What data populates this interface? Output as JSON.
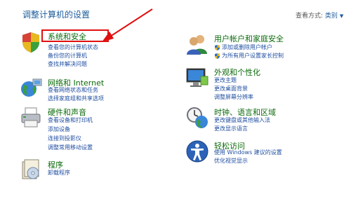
{
  "header": {
    "title": "调整计算机的设置",
    "view_by_label": "查看方式:",
    "view_by_value": "类别"
  },
  "categories_left": [
    {
      "title": "系统和安全",
      "links": [
        "查看您的计算机状态",
        "备份您的计算机",
        "查找并解决问题"
      ]
    },
    {
      "title": "网络和 Internet",
      "links": [
        "查看网络状态和任务",
        "选择家庭组和共享选项"
      ]
    },
    {
      "title": "硬件和声音",
      "links": [
        "查看设备和打印机",
        "添加设备",
        "连接到投影仪",
        "调整常用移动设置"
      ]
    },
    {
      "title": "程序",
      "links": [
        "卸载程序"
      ]
    }
  ],
  "categories_right": [
    {
      "title": "用户帐户和家庭安全",
      "links": [
        "添加或删除用户帐户",
        "为所有用户设置家长控制"
      ]
    },
    {
      "title": "外观和个性化",
      "links": [
        "更改主题",
        "更改桌面背景",
        "调整屏幕分辨率"
      ]
    },
    {
      "title": "时钟、语言和区域",
      "links": [
        "更改键盘或其他输入法",
        "更改显示语言"
      ]
    },
    {
      "title": "轻松访问",
      "links": [
        "使用 Windows 建议的设置",
        "优化视觉显示"
      ]
    }
  ],
  "annotation": {
    "color": "#e01010"
  }
}
